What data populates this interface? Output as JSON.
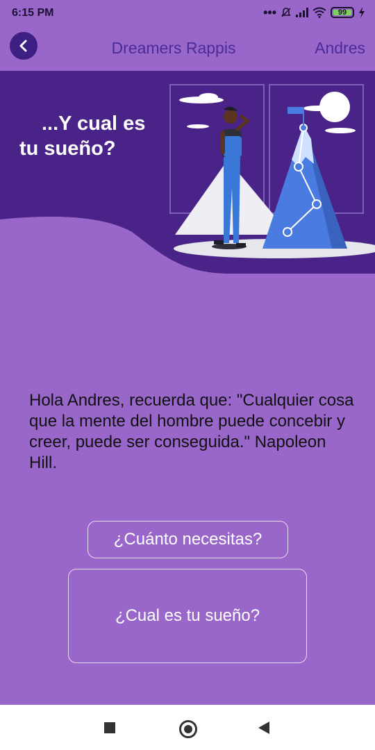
{
  "status_bar": {
    "time": "6:15 PM",
    "battery": "99"
  },
  "header": {
    "title": "Dreamers Rappis",
    "user": "Andres"
  },
  "banner": {
    "line1": "...Y cual es",
    "line2": "tu sueño?"
  },
  "quote": "Hola Andres, recuerda que: \"Cualquier cosa que la mente del hombre puede concebir y creer, puede ser conseguida.\" Napoleon Hill.",
  "buttons": {
    "need": "¿Cuánto necesitas?",
    "dream": "¿Cual es tu sueño?"
  },
  "colors": {
    "background": "#9966c9",
    "banner": "#4a2388",
    "accent": "#3d1f83"
  }
}
